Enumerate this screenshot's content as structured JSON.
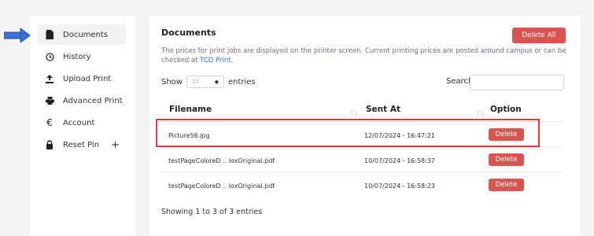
{
  "sidebar": {
    "items": [
      {
        "label": "Documents",
        "icon": "document-icon"
      },
      {
        "label": "History",
        "icon": "history-icon"
      },
      {
        "label": "Upload Print",
        "icon": "upload-icon"
      },
      {
        "label": "Advanced Print",
        "icon": "printer-icon"
      },
      {
        "label": "Account",
        "icon": "euro-icon"
      },
      {
        "label": "Reset Pin",
        "icon": "lock-icon",
        "expand": "+"
      }
    ]
  },
  "main": {
    "title": "Documents",
    "delete_all_label": "Delete All",
    "info_text": "The prices for print jobs are displayed on the printer screen. Current printing prices are posted around campus or can be checked at ",
    "info_link": "TCD Print.",
    "show_label": "Show",
    "entries_select": "10",
    "entries_label": "entries",
    "search_label": "Search:",
    "columns": [
      "Filename",
      "Sent At",
      "Option"
    ],
    "rows": [
      {
        "filename": "Picture56.jpg",
        "sent_at": "12/07/2024 - 16:47:21",
        "option": "Delete"
      },
      {
        "filename": "testPageColoreD .. loxOriginal.pdf",
        "sent_at": "10/07/2024 - 16:58:37",
        "option": "Delete"
      },
      {
        "filename": "testPageColoreD .. loxOriginal.pdf",
        "sent_at": "10/07/2024 - 16:58:23",
        "option": "Delete"
      }
    ],
    "footer": "Showing 1 to 3 of 3 entries"
  },
  "colors": {
    "danger": "#d9534f",
    "highlight": "#e33b3b",
    "link": "#2b7bd6",
    "pointer_arrow": "#3a6fd8"
  }
}
